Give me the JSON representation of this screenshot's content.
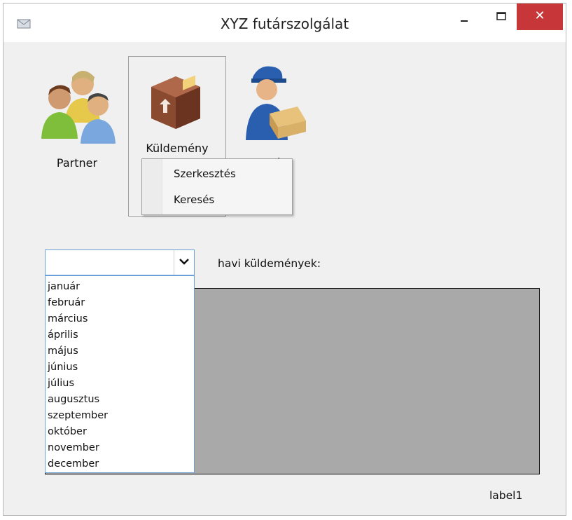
{
  "window": {
    "title": "XYZ futárszolgálat",
    "close_glyph": "✕"
  },
  "toolbar": {
    "partner_label": "Partner",
    "kuldemeny_label": "Küldemény",
    "futar_label": "Futár"
  },
  "menu": {
    "items": [
      "Szerkesztés",
      "Keresés"
    ]
  },
  "combo": {
    "value": "",
    "arrow_glyph": "⌄"
  },
  "months": [
    "január",
    "február",
    "március",
    "április",
    "május",
    "június",
    "július",
    "augusztus",
    "szeptember",
    "október",
    "november",
    "december"
  ],
  "monthly_label": "havi küldemények:",
  "status_label": "label1",
  "colors": {
    "close_button": "#c7373a",
    "panel": "#a9a9a9",
    "combo_border": "#6a9fd8"
  }
}
